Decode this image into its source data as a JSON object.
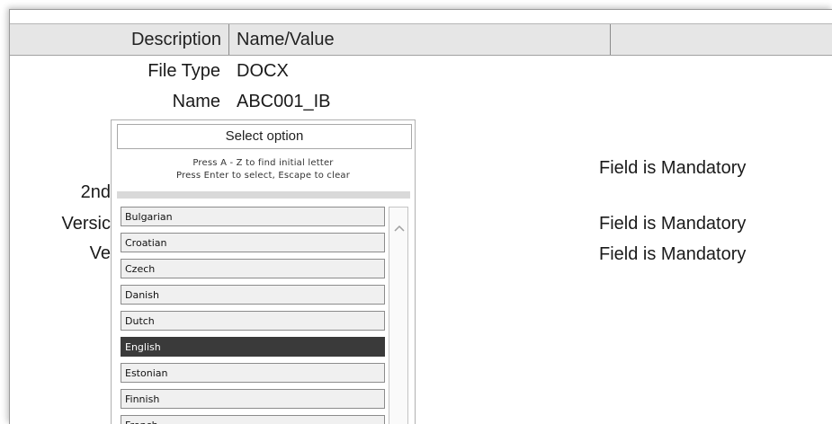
{
  "header": {
    "description": "Description",
    "name_value": "Name/Value"
  },
  "rows": [
    {
      "label": "File Type",
      "value": "DOCX"
    },
    {
      "label": "Name",
      "value": "ABC001_IB"
    }
  ],
  "partial_labels": [
    "2nd",
    "Versic",
    "Ve"
  ],
  "mandatory_text": [
    "Field is Mandatory",
    "Field is Mandatory",
    "Field is Mandatory"
  ],
  "popup": {
    "title": "Select option",
    "hint1": "Press A - Z to find initial letter",
    "hint2": "Press Enter to select, Escape to clear",
    "options": [
      "Bulgarian",
      "Croatian",
      "Czech",
      "Danish",
      "Dutch",
      "English",
      "Estonian",
      "Finnish",
      "French"
    ],
    "selected": "English"
  },
  "icons": {
    "scroll_up": "chevron-up-icon"
  }
}
